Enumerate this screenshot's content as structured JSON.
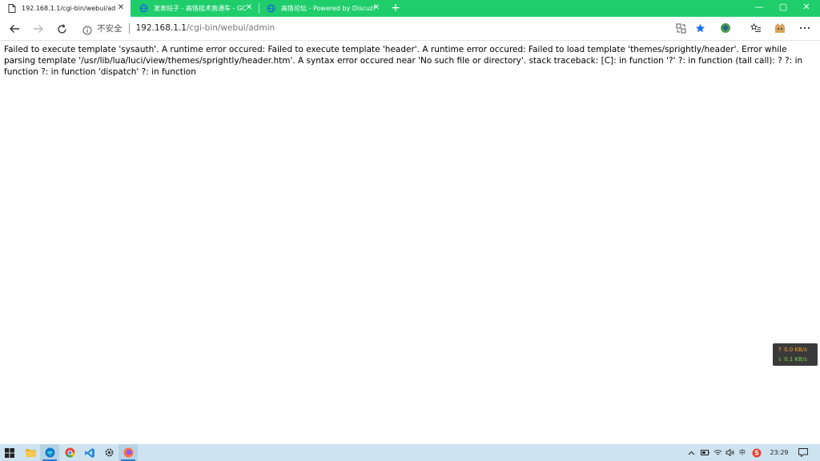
{
  "browser": {
    "tabs": [
      {
        "title": "192.168.1.1/cgi-bin/webui/admi",
        "icon": "page-icon",
        "active": true
      },
      {
        "title": "发表帖子 - 高恪技术直通车 - GC",
        "icon": "globe-icon",
        "active": false
      },
      {
        "title": "高恪论坛 - Powered by Discuz!",
        "icon": "globe-icon",
        "active": false
      }
    ],
    "new_tab_label": "+",
    "window_controls": {
      "minimize": "—",
      "maximize": "▢",
      "close": "✕"
    },
    "address": {
      "security_label": "不安全",
      "url_host": "192.168.1.1",
      "url_path": "/cgi-bin/webui/admin"
    }
  },
  "page": {
    "error_text": "Failed to execute template 'sysauth'. A runtime error occured: Failed to execute template 'header'. A runtime error occured: Failed to load template 'themes/sprightly/header'. Error while parsing template '/usr/lib/lua/luci/view/themes/sprightly/header.htm'. A syntax error occured near 'No such file or directory'. stack traceback: [C]: in function '?' ?: in function (tail call): ? ?: in function ?: in function 'dispatch' ?: in function"
  },
  "speed_widget": {
    "upload": "↑ 0.0 KB/s",
    "download": "↓ 0.1 KB/s"
  },
  "taskbar": {
    "ime_label": "中",
    "clock": "23:29"
  },
  "colors": {
    "tabstrip": "#1fce6b",
    "taskbar": "#cde4f0",
    "star": "#1a73e8"
  }
}
